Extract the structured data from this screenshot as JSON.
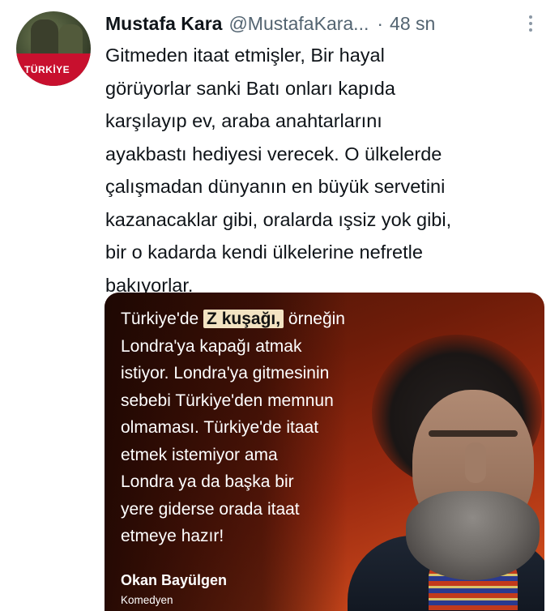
{
  "tweet": {
    "author_name": "Mustafa Kara",
    "author_handle": "@MustafaKara...",
    "separator": "·",
    "time": "48 sn",
    "avatar_badge": "TÜRKİYE",
    "text_lines": [
      "Gitmeden itaat etmişler, Bir hayal",
      "görüyorlar sanki Batı onları kapıda",
      "karşılayıp ev, araba anahtarlarını",
      "ayakbastı hediyesi verecek. O ülkelerde",
      "çalışmadan dünyanın en büyük servetini",
      "kazanacaklar gibi, oralarda ışsiz yok gibi,",
      "bir o kadarda kendi ülkelerine nefretle",
      "bakıyorlar."
    ]
  },
  "media": {
    "quote_prefix": "Türkiye'de ",
    "quote_highlight": "Z kuşağı,",
    "quote_lines": [
      " örneğin",
      "Londra'ya kapağı atmak",
      "istiyor. Londra'ya gitmesinin",
      "sebebi Türkiye'den memnun",
      "olmaması. Türkiye'de itaat",
      "etmek istemiyor ama",
      "Londra ya da başka bir",
      "yere giderse orada itaat",
      "etmeye hazır!"
    ],
    "credit_name": "Okan Bayülgen",
    "credit_role": "Komedyen"
  }
}
